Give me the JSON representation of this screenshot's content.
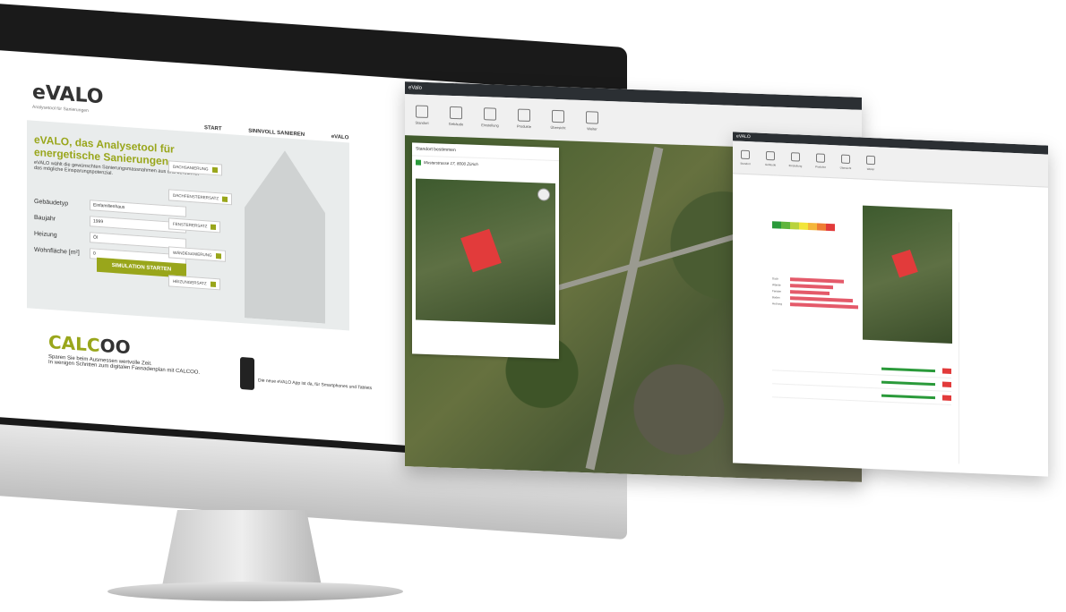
{
  "evalo": {
    "logo": "eVALO",
    "logo_tagline": "Analysetool für Sanierungen",
    "nav": [
      "START",
      "SINNVOLL SANIEREN",
      "eVALO"
    ],
    "hero_title": "eVALO, das Analysetool für energetische Sanierungen.",
    "hero_text": "eVALO wählt die gewünschten Sanierungsmassnahmen aus und berechnet das mögliche Einsparungspotenzial.",
    "form": [
      {
        "label": "Gebäudetyp",
        "value": "Einfamilienhaus"
      },
      {
        "label": "Baujahr",
        "value": "1999"
      },
      {
        "label": "Heizung",
        "value": "Öl"
      },
      {
        "label": "Wohnfläche [m²]",
        "value": "0"
      }
    ],
    "sim_button": "SIMULATION STARTEN",
    "tags": [
      "DACHSANIERUNG",
      "DACHFENSTERERSATZ",
      "FENSTERERSATZ",
      "WÄNDESANIERUNG",
      "HEIZUNGERSATZ"
    ]
  },
  "calcoo": {
    "logo_a": "CALC",
    "logo_b": "OO",
    "text1": "Sparen Sie beim Ausmessen wertvolle Zeit.",
    "text2": "In wenigen Schritten zum digitalen Fassadenplan mit CALCOO.",
    "app_text": "Die neue eVALO App ist da, für Smartphones und Tablets"
  },
  "map_screen": {
    "title": "eValo",
    "tools": [
      "Standort",
      "Gebäude",
      "Einstellung",
      "Produkte",
      "Übersicht",
      "Weiter"
    ],
    "panel_title": "Standort bestimmen",
    "address": "Musterstrasse 17, 8000 Zürich"
  },
  "analysis_screen": {
    "title": "eVALO",
    "tools": [
      "Standort",
      "Gebäude",
      "Einstellung",
      "Produkte",
      "Übersicht",
      "Weiter"
    ],
    "energy_colors": [
      "#2a9a3a",
      "#5fb53d",
      "#b9d33c",
      "#f2e53a",
      "#f5b63a",
      "#ef7d34",
      "#e23b3b"
    ],
    "rows": [
      "Dach",
      "Wände",
      "Fenster",
      "Boden",
      "Heizung"
    ]
  }
}
